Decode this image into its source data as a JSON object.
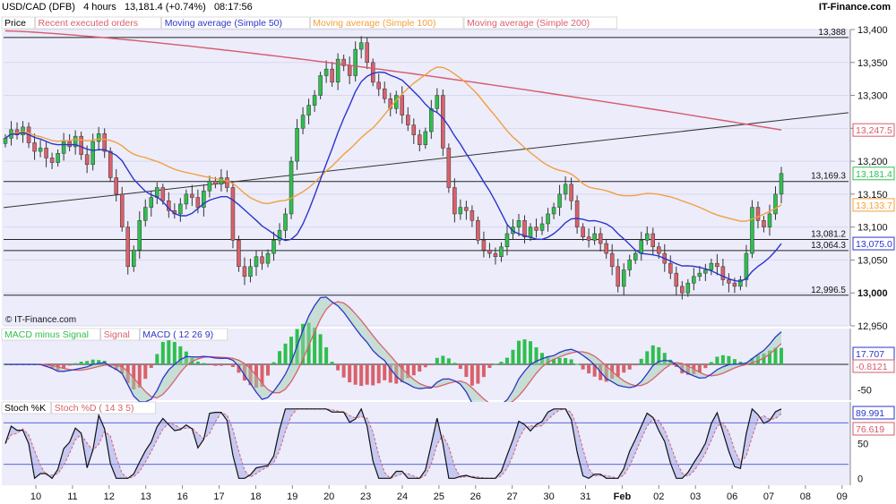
{
  "header": {
    "instrument": "USD/CAD (DFB)",
    "timeframe": "4 hours",
    "price_change": "13,181.4 (+0.74%)",
    "time": "08:17:56",
    "brand": "IT-Finance.com"
  },
  "colors": {
    "up": "#2fbf4f",
    "down": "#d9616b",
    "ma50": "#2a35c9",
    "ma100": "#f2a03d",
    "ma200": "#d65a6a",
    "trend": "#333333",
    "grid_bg": "#ececfb"
  },
  "chart_data": [
    {
      "type": "candlestick",
      "title": "Price",
      "legend": [
        "Recent executed orders",
        "Moving average (Simple 50)",
        "Moving average (Simple 100)",
        "Moving average (Simple 200)"
      ],
      "ylim": [
        12950,
        13400
      ],
      "y_ticks": [
        12950,
        13000,
        13050,
        13100,
        13150,
        13200,
        13250,
        13300,
        13350,
        13400
      ],
      "y_tick_labels": [
        "12,950",
        "13,000",
        "13,050",
        "13,100",
        "13,150",
        "13,200",
        "13,250",
        "13,300",
        "13,350",
        "13,400"
      ],
      "levels": [
        {
          "value": 13388,
          "label": "13,388"
        },
        {
          "value": 13169.3,
          "label": "13,169.3"
        },
        {
          "value": 13081.2,
          "label": "13,081.2"
        },
        {
          "value": 13064.3,
          "label": "13,064.3"
        },
        {
          "value": 12996.5,
          "label": "12,996.5"
        }
      ],
      "price_tags": [
        {
          "value": 13247.5,
          "label": "13,247.5",
          "color": "#d65a6a"
        },
        {
          "value": 13181.4,
          "label": "13,181.4",
          "color": "#2fbf4f"
        },
        {
          "value": 13133.7,
          "label": "13,133.7",
          "color": "#f2a03d"
        },
        {
          "value": 13075.0,
          "label": "13,075.0",
          "color": "#2a35c9"
        }
      ],
      "trendline": {
        "from": 13169,
        "to": 13271
      },
      "closes": [
        13235,
        13248,
        13240,
        13252,
        13228,
        13215,
        13220,
        13205,
        13198,
        13212,
        13230,
        13222,
        13238,
        13210,
        13195,
        13230,
        13242,
        13215,
        13175,
        13150,
        13100,
        13040,
        13065,
        13110,
        13130,
        13145,
        13160,
        13140,
        13125,
        13120,
        13135,
        13150,
        13145,
        13130,
        13155,
        13170,
        13165,
        13175,
        13160,
        13080,
        13040,
        13025,
        13040,
        13055,
        13045,
        13060,
        13080,
        13095,
        13120,
        13200,
        13250,
        13270,
        13285,
        13300,
        13330,
        13340,
        13320,
        13355,
        13345,
        13330,
        13370,
        13380,
        13350,
        13320,
        13310,
        13295,
        13280,
        13300,
        13270,
        13255,
        13240,
        13225,
        13245,
        13280,
        13300,
        13220,
        13160,
        13120,
        13130,
        13125,
        13110,
        13080,
        13065,
        13060,
        13055,
        13070,
        13090,
        13100,
        13110,
        13085,
        13100,
        13095,
        13105,
        13120,
        13130,
        13150,
        13165,
        13140,
        13100,
        13085,
        13080,
        13090,
        13075,
        13060,
        13040,
        13010,
        13035,
        13050,
        13060,
        13080,
        13090,
        13070,
        13060,
        13045,
        13030,
        13010,
        13000,
        13015,
        13025,
        13030,
        13035,
        13045,
        13040,
        13020,
        13015,
        13010,
        13020,
        13060,
        13130,
        13110,
        13100,
        13120,
        13150,
        13181.4
      ],
      "ma50_tail": 13075.0,
      "ma100_tail": 13133.7,
      "ma200_tail": 13247.5
    },
    {
      "type": "bar",
      "title": "MACD",
      "legend": [
        "MACD minus Signal",
        "Signal",
        "MACD ( 12 26 9)"
      ],
      "ylim": [
        -70,
        70
      ],
      "y_ticks": [
        -50
      ],
      "y_tick_labels": [
        "-50"
      ],
      "tags": [
        {
          "value": 17.707,
          "label": "17.707",
          "color": "#2a35c9"
        },
        {
          "value": -0.8121,
          "label": "-0.8121",
          "color": "#d65a6a"
        }
      ]
    },
    {
      "type": "line",
      "title": "Stoch %K",
      "legend": [
        "Stoch %K",
        "Stoch %D ( 14 3 5)"
      ],
      "ylim": [
        -10,
        110
      ],
      "y_ticks": [
        0,
        50
      ],
      "y_tick_labels": [
        "0",
        "50"
      ],
      "tags": [
        {
          "value": 89.991,
          "label": "89.991",
          "color": "#2a35c9"
        },
        {
          "value": 76.619,
          "label": "76.619",
          "color": "#d65a6a"
        }
      ],
      "bands": [
        80,
        20
      ]
    }
  ],
  "x_axis": {
    "labels": [
      "10",
      "11",
      "12",
      "13",
      "16",
      "17",
      "18",
      "19",
      "20",
      "23",
      "24",
      "25",
      "26",
      "27",
      "30",
      "31",
      "Feb",
      "02",
      "03",
      "06",
      "07",
      "08",
      "09"
    ]
  }
}
